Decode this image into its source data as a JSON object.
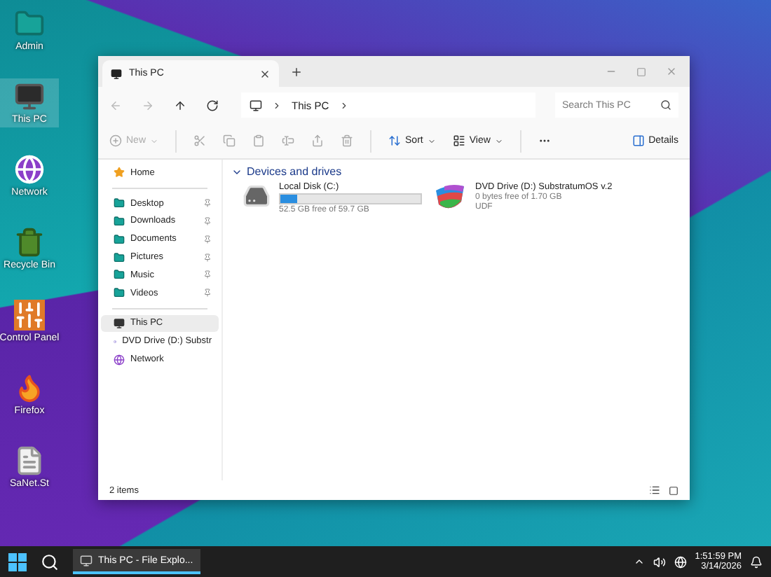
{
  "desktop_icons": [
    {
      "label": "Admin",
      "kind": "folder",
      "selected": false
    },
    {
      "label": "This PC",
      "kind": "pc",
      "selected": true
    },
    {
      "label": "Network",
      "kind": "network",
      "selected": false
    },
    {
      "label": "Recycle Bin",
      "kind": "bin",
      "selected": false
    },
    {
      "label": "Control Panel",
      "kind": "control",
      "selected": false
    },
    {
      "label": "Firefox",
      "kind": "browser",
      "selected": false
    },
    {
      "label": "SaNet.St",
      "kind": "file",
      "selected": false
    }
  ],
  "window": {
    "tab": {
      "title": "This PC"
    },
    "address": {
      "path": [
        "This PC"
      ]
    },
    "search": {
      "placeholder": "Search This PC"
    },
    "toolbar": [
      {
        "kind": "new",
        "label": "New",
        "disabled": true
      },
      {
        "kind": "cut",
        "disabled": true
      },
      {
        "kind": "copy",
        "disabled": true
      },
      {
        "kind": "paste",
        "disabled": true
      },
      {
        "kind": "rename",
        "disabled": true
      },
      {
        "kind": "share",
        "disabled": true
      },
      {
        "kind": "delete",
        "disabled": true
      },
      {
        "kind": "sort",
        "label": "Sort",
        "disabled": false
      },
      {
        "kind": "view",
        "label": "View",
        "disabled": false
      },
      {
        "kind": "more",
        "disabled": false
      }
    ],
    "details": "Details",
    "sidebar": [
      {
        "label": "Home",
        "kind": "home",
        "pinned": false,
        "selected": false
      },
      {
        "label": "Desktop",
        "kind": "folder",
        "pinned": true,
        "selected": false
      },
      {
        "label": "Downloads",
        "kind": "folder",
        "pinned": true,
        "selected": false
      },
      {
        "label": "Documents",
        "kind": "folder",
        "pinned": true,
        "selected": false
      },
      {
        "label": "Pictures",
        "kind": "folder",
        "pinned": true,
        "selected": false
      },
      {
        "label": "Music",
        "kind": "folder",
        "pinned": true,
        "selected": false
      },
      {
        "label": "Videos",
        "kind": "folder",
        "pinned": true,
        "selected": false
      },
      {
        "label": "This PC",
        "kind": "pc",
        "pinned": false,
        "selected": true
      },
      {
        "label": "DVD Drive (D:) Substr",
        "kind": "dvd",
        "pinned": false,
        "selected": false
      },
      {
        "label": "Network",
        "kind": "network",
        "pinned": false,
        "selected": false
      }
    ],
    "section": {
      "title": "Devices and drives",
      "expanded": true
    },
    "drives": [
      {
        "name": "Local Disk (C:)",
        "kind": "disk",
        "level": 0.12,
        "free": "52.5 GB free of 59.7 GB"
      },
      {
        "name": "DVD Drive (D:) SubstratumOS v.2",
        "kind": "dvd",
        "free": "0 bytes free of 1.70 GB",
        "filesystem": "UDF"
      }
    ],
    "status": "2 items"
  },
  "taskbar": {
    "app": "This PC - File Explo...",
    "time": "1:51:59 PM",
    "date": "3/14/2026"
  }
}
